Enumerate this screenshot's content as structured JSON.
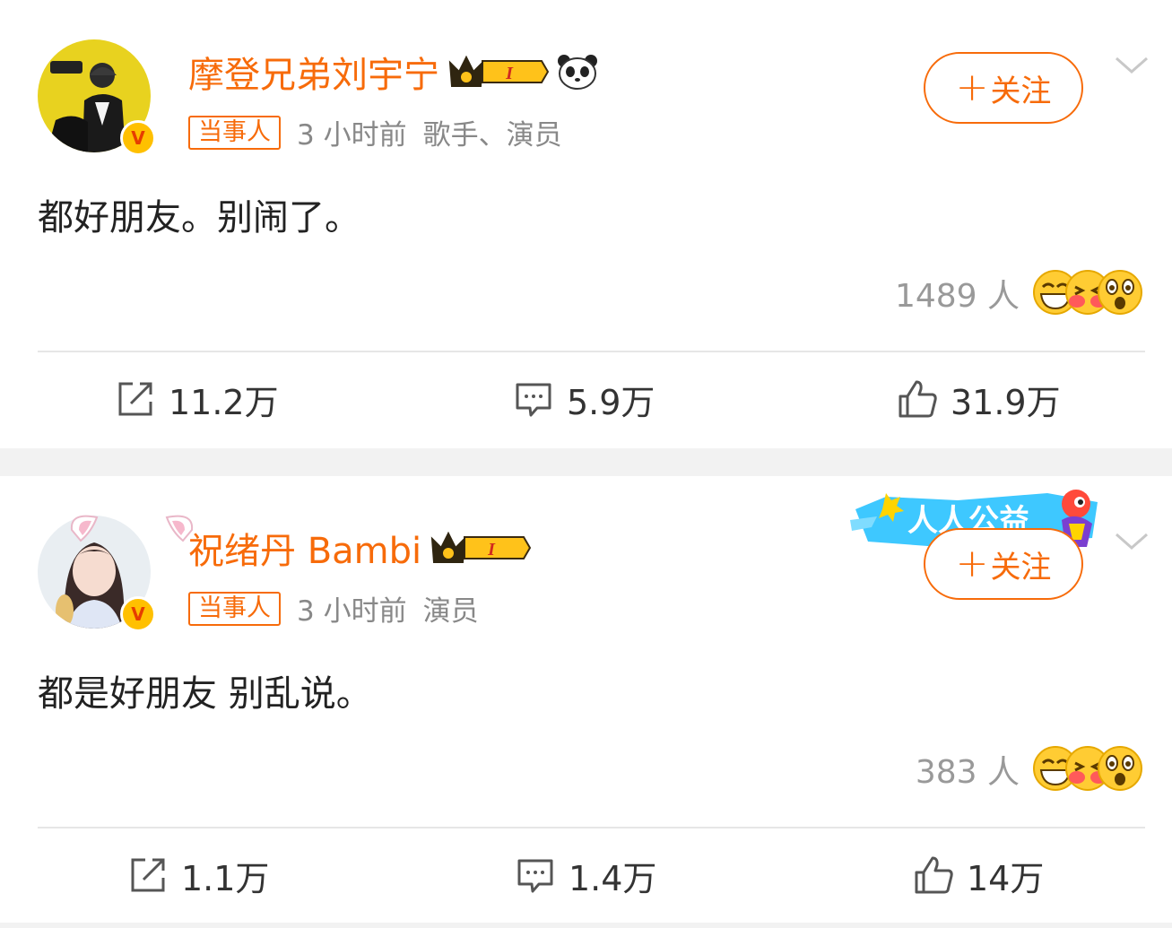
{
  "posts": [
    {
      "name": "摩登兄弟刘宇宁",
      "tag": "当事人",
      "time": "3 小时前",
      "identity": "歌手、演员",
      "follow": "关注",
      "content": "都好朋友。别闹了。",
      "reaction_count": "1489 人",
      "reposts": "11.2万",
      "comments": "5.9万",
      "likes": "31.9万",
      "badge_letter": "V",
      "level": "I"
    },
    {
      "name": "祝绪丹 Bambi",
      "tag": "当事人",
      "time": "3 小时前",
      "identity": "演员",
      "follow": "关注",
      "content": "都是好朋友 别乱说。",
      "reaction_count": "383 人",
      "reposts": "1.1万",
      "comments": "1.4万",
      "likes": "14万",
      "badge_letter": "V",
      "level": "I",
      "banner_text": "人人公益"
    }
  ],
  "icons": {
    "repost": "repost-icon",
    "comment": "comment-icon",
    "like": "thumbs-up-icon",
    "more": "chevron-down-icon"
  },
  "colors": {
    "accent": "#f76b0a",
    "badge": "#ffc000",
    "muted": "#888888",
    "divider": "#e6e6e6",
    "separator": "#f2f2f2"
  }
}
